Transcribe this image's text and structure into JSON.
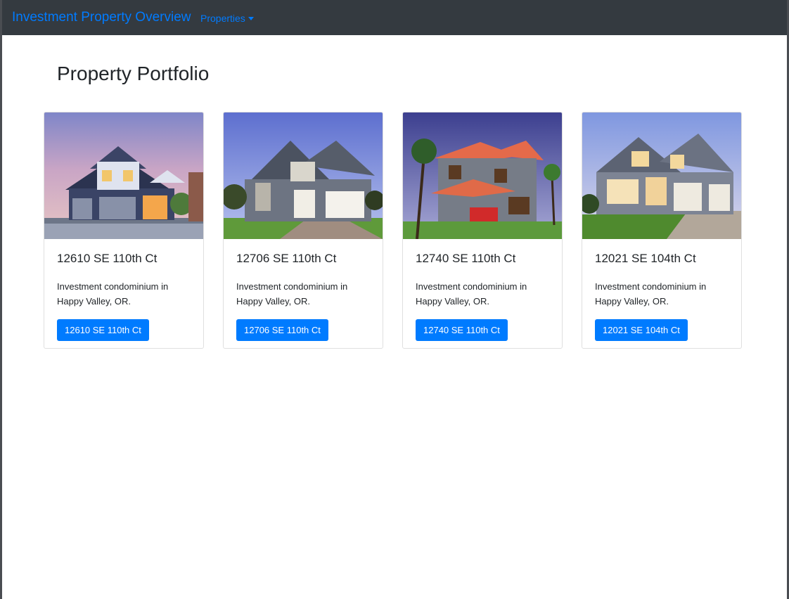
{
  "navbar": {
    "brand": "Investment Property Overview",
    "dropdown_label": "Properties"
  },
  "page_title": "Property Portfolio",
  "properties": [
    {
      "title": "12610 SE 110th Ct",
      "description": "Investment condominium in Happy Valley, OR.",
      "button_label": "12610 SE 110th Ct"
    },
    {
      "title": "12706 SE 110th Ct",
      "description": "Investment condominium in Happy Valley, OR.",
      "button_label": "12706 SE 110th Ct"
    },
    {
      "title": "12740 SE 110th Ct",
      "description": "Investment condominium in Happy Valley, OR.",
      "button_label": "12740 SE 110th Ct"
    },
    {
      "title": "12021 SE 104th Ct",
      "description": "Investment condominium in Happy Valley, OR.",
      "button_label": "12021 SE 104th Ct"
    }
  ],
  "colors": {
    "navbar_bg": "#343a40",
    "link": "#007bff",
    "button_bg": "#007bff"
  }
}
